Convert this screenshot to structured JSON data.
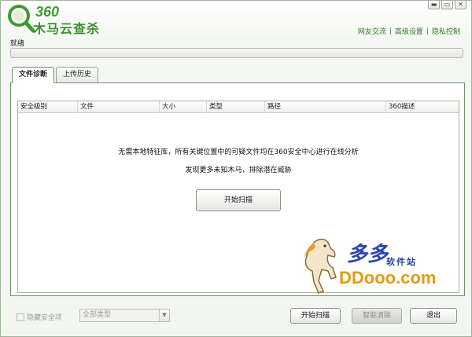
{
  "app": {
    "logo_number": "360",
    "logo_name": "木马云查杀"
  },
  "window_controls": {
    "minimize": "▬",
    "restore": "▭",
    "close": "✕"
  },
  "top_links": [
    {
      "label": "网友交流"
    },
    {
      "label": "高级设置"
    },
    {
      "label": "隐私控制"
    }
  ],
  "separator": "|",
  "status": {
    "text": "就绪",
    "progress": 0
  },
  "tabs": [
    {
      "label": "文件诊断",
      "active": true
    },
    {
      "label": "上传历史",
      "active": false
    }
  ],
  "table": {
    "columns": [
      "安全级别",
      "文件",
      "大小",
      "类型",
      "路径",
      "360描述"
    ]
  },
  "messages": {
    "line1": "无需本地特征库，所有关键位置中的可疑文件均在360安全中心进行在线分析",
    "line2": "发现更多未知木马，排除潜在威胁"
  },
  "center_button": {
    "label": "开始扫描"
  },
  "watermark": {
    "cn": "多多",
    "site": "软件站",
    "url": "DDooo.com"
  },
  "bottom": {
    "hide_safe_label": "隐藏安全项",
    "filter_value": "全部类型",
    "scan_label": "开始扫描",
    "clean_label": "智能清除",
    "exit_label": "退出"
  },
  "colors": {
    "brand_green": "#3e9b2e",
    "link_green": "#2f7a1f",
    "panel_border": "#6d8f67"
  }
}
